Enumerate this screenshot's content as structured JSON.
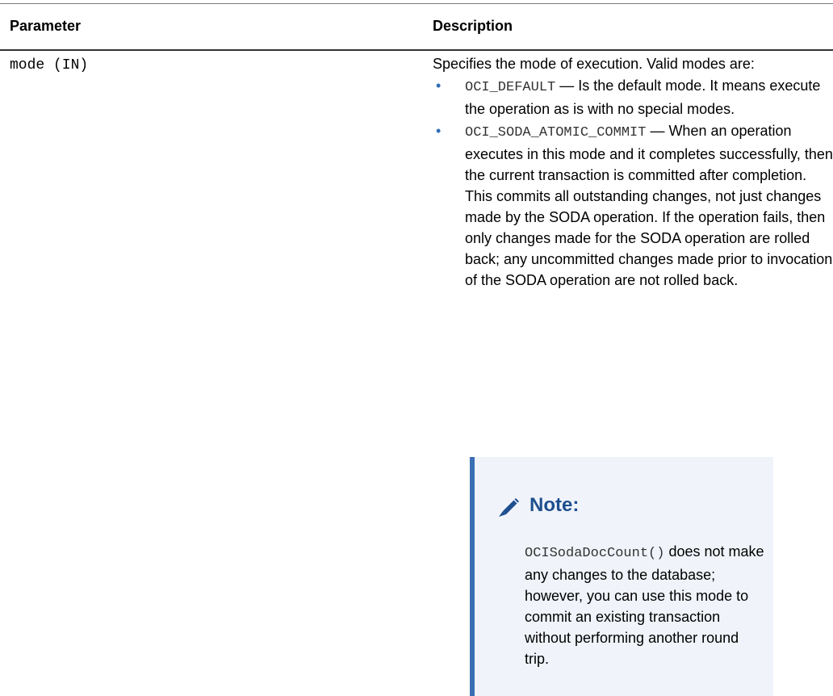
{
  "table": {
    "headers": {
      "parameter": "Parameter",
      "description": "Description"
    },
    "rows": [
      {
        "parameter": "mode (IN)",
        "intro": "Specifies the mode of execution. Valid modes are:",
        "modes": [
          {
            "code": "OCI_DEFAULT",
            "text": " — Is the default mode. It means execute the operation as is with no special modes."
          },
          {
            "code": "OCI_SODA_ATOMIC_COMMIT",
            "text": " — When an operation executes in this mode and it completes successfully, then the current transaction is committed after completion. This commits all outstanding changes, not just changes made by the SODA operation. If the operation fails, then only changes made for the SODA operation are rolled back; any uncommitted changes made prior to invocation of the SODA operation are not rolled back."
          }
        ]
      }
    ]
  },
  "note": {
    "title": "Note:",
    "icon": "pencil-icon",
    "code": "OCISodaDocCount()",
    "text": " does not make any changes to the database; however, you can use this mode to commit an existing transaction without performing another round trip."
  },
  "colors": {
    "bullet": "#2f6db5",
    "note_border": "#3a6fb5",
    "note_background": "#f0f4fa",
    "note_title": "#1e4f8f"
  }
}
